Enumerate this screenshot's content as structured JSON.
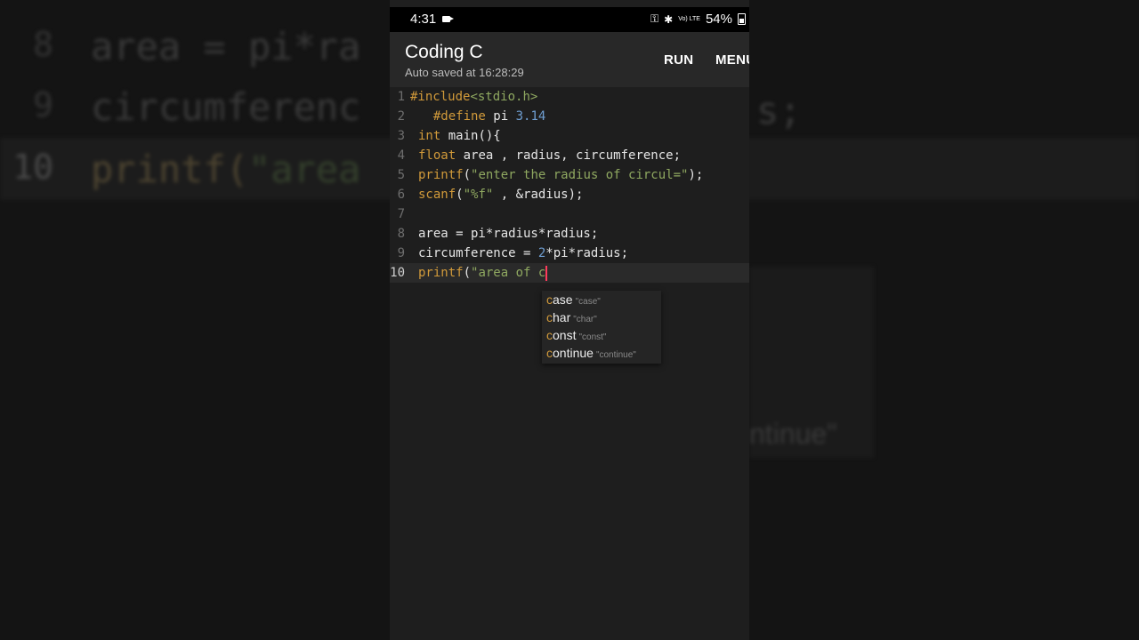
{
  "background_echo": {
    "lines": [
      {
        "num": "8",
        "text": "area = pi*ra"
      },
      {
        "num": "9",
        "text": "circumferenc"
      },
      {
        "num": "10",
        "kw": "printf(",
        "str": "\"area"
      }
    ],
    "right_fragment": "s;",
    "popup_fragment": "ntinue\""
  },
  "status_bar": {
    "time": "4:31",
    "battery": "54%",
    "network": "Vo) LTE"
  },
  "app_bar": {
    "title": "Coding C",
    "subtitle": "Auto saved at 16:28:29",
    "run_label": "RUN",
    "menu_label": "MENU"
  },
  "editor": {
    "lines": [
      {
        "num": "1",
        "segments": [
          {
            "t": "kw",
            "v": "#include"
          },
          {
            "t": "str",
            "v": "<stdio.h>"
          }
        ]
      },
      {
        "num": "2",
        "segments": [
          {
            "t": "plain",
            "v": "  "
          },
          {
            "t": "kw",
            "v": "#define"
          },
          {
            "t": "plain",
            "v": " pi "
          },
          {
            "t": "num",
            "v": "3.14"
          }
        ]
      },
      {
        "num": "3",
        "segments": [
          {
            "t": "kw",
            "v": "int"
          },
          {
            "t": "plain",
            "v": " main(){"
          }
        ]
      },
      {
        "num": "4",
        "segments": [
          {
            "t": "kw",
            "v": "float"
          },
          {
            "t": "plain",
            "v": " area , radius, circumference;"
          }
        ]
      },
      {
        "num": "5",
        "segments": [
          {
            "t": "kw",
            "v": "printf"
          },
          {
            "t": "plain",
            "v": "("
          },
          {
            "t": "str",
            "v": "\"enter the radius of circul=\""
          },
          {
            "t": "plain",
            "v": ");"
          }
        ]
      },
      {
        "num": "6",
        "segments": [
          {
            "t": "kw",
            "v": "scanf"
          },
          {
            "t": "plain",
            "v": "("
          },
          {
            "t": "str",
            "v": "\"%f\""
          },
          {
            "t": "plain",
            "v": " , &radius);"
          }
        ]
      },
      {
        "num": "7",
        "segments": []
      },
      {
        "num": "8",
        "segments": [
          {
            "t": "plain",
            "v": "area = pi*radius*radius;"
          }
        ]
      },
      {
        "num": "9",
        "segments": [
          {
            "t": "plain",
            "v": "circumference = "
          },
          {
            "t": "num",
            "v": "2"
          },
          {
            "t": "plain",
            "v": "*pi*radius;"
          }
        ]
      },
      {
        "num": "10",
        "segments": [
          {
            "t": "kw",
            "v": "printf"
          },
          {
            "t": "plain",
            "v": "("
          },
          {
            "t": "str",
            "v": "\"area of c"
          }
        ]
      }
    ],
    "active_line": 10
  },
  "autocomplete": {
    "items": [
      {
        "match": "c",
        "rest": "ase",
        "hint": "\"case\""
      },
      {
        "match": "c",
        "rest": "har",
        "hint": "\"char\""
      },
      {
        "match": "c",
        "rest": "onst",
        "hint": "\"const\""
      },
      {
        "match": "c",
        "rest": "ontinue",
        "hint": "\"continue\""
      }
    ]
  },
  "colors": {
    "keyword": "#d19a3a",
    "string": "#8fa860",
    "number": "#6f9ed1",
    "caret": "#ff3b5c",
    "editor_bg": "#1e1e1e",
    "appbar_bg": "#282828"
  }
}
